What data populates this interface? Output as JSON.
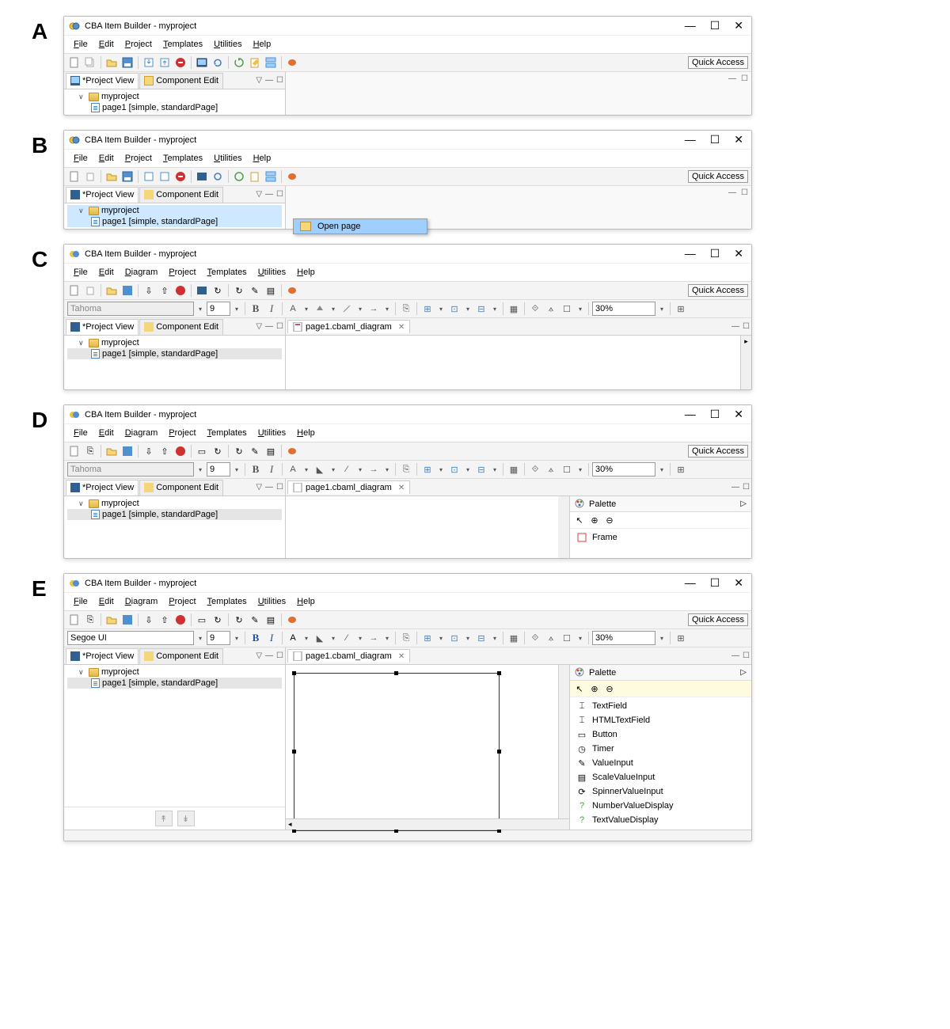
{
  "labels": {
    "A": "A",
    "B": "B",
    "C": "C",
    "D": "D",
    "E": "E"
  },
  "title": "CBA Item Builder - myproject",
  "menu_short": [
    "File",
    "Edit",
    "Project",
    "Templates",
    "Utilities",
    "Help"
  ],
  "menu_full": [
    "File",
    "Edit",
    "Diagram",
    "Project",
    "Templates",
    "Utilities",
    "Help"
  ],
  "quick_access": "Quick Access",
  "tabs": {
    "project_view": "*Project View",
    "component_edit": "Component Edit"
  },
  "tree": {
    "project": "myproject",
    "page": "page1 [simple, standardPage]"
  },
  "context_menu": {
    "open_page": "Open page"
  },
  "editor_tab": "page1.cbaml_diagram",
  "font_tahoma": "Tahoma",
  "font_segoe": "Segoe UI",
  "font_size": "9",
  "zoom": "30%",
  "palette": {
    "title": "Palette",
    "frame": "Frame",
    "items": [
      "TextField",
      "HTMLTextField",
      "Button",
      "Timer",
      "ValueInput",
      "ScaleValueInput",
      "SpinnerValueInput",
      "NumberValueDisplay",
      "TextValueDisplay"
    ]
  }
}
